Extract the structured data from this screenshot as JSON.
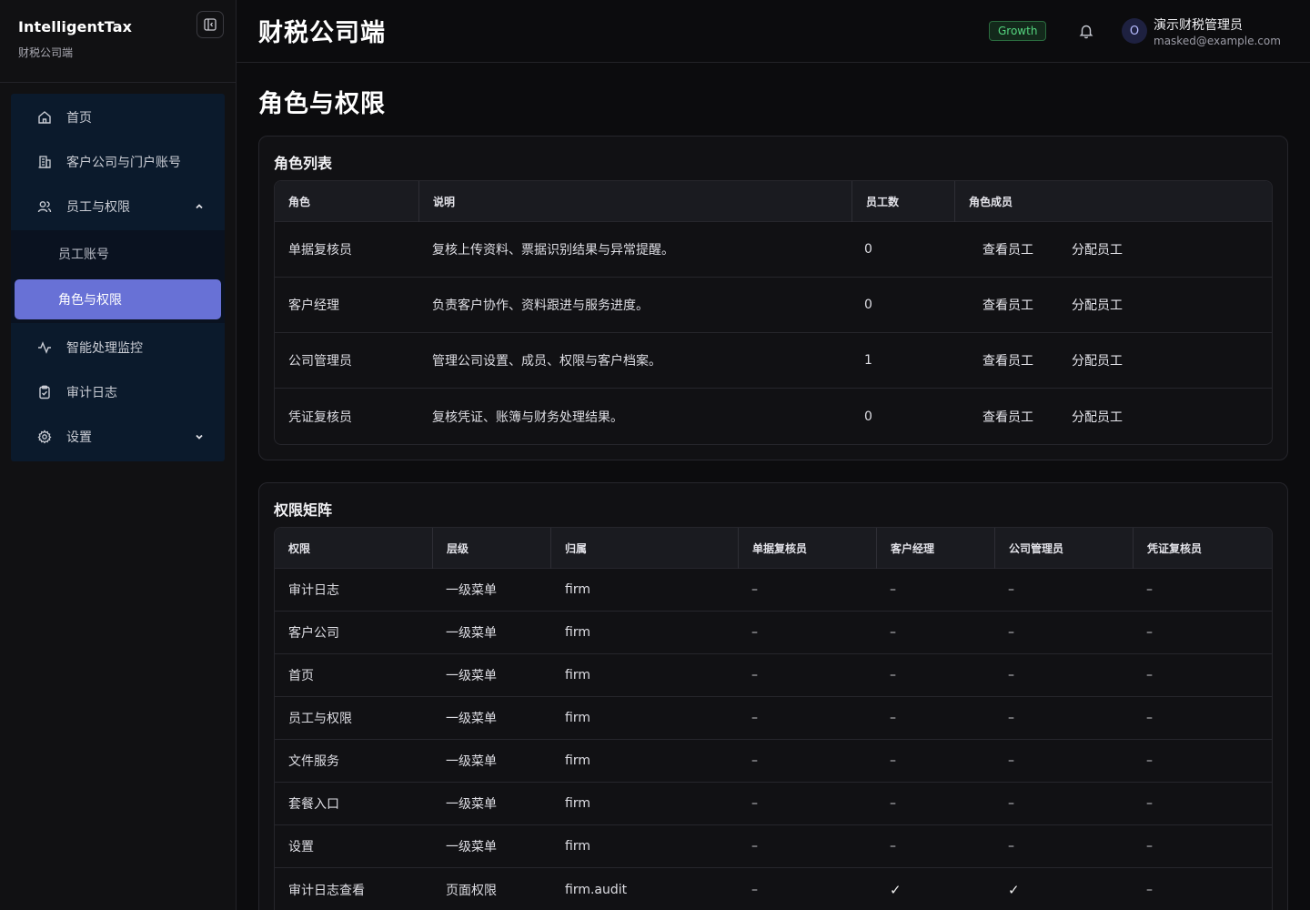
{
  "sidebar": {
    "brand_title": "IntelligentTax",
    "brand_subtitle": "财税公司端",
    "items": [
      {
        "label": "首页",
        "icon": "home-icon"
      },
      {
        "label": "客户公司与门户账号",
        "icon": "building-icon"
      },
      {
        "label": "员工与权限",
        "icon": "users-icon",
        "expanded": true
      },
      {
        "label": "员工账号",
        "sub": true
      },
      {
        "label": "角色与权限",
        "sub": true,
        "active": true
      },
      {
        "label": "智能处理监控",
        "icon": "activity-icon"
      },
      {
        "label": "审计日志",
        "icon": "clipboard-check-icon"
      },
      {
        "label": "设置",
        "icon": "gear-icon",
        "expanded": false
      }
    ]
  },
  "header": {
    "title": "财税公司端",
    "plan_badge": "Growth",
    "avatar_initial": "O",
    "user_name": "演示财税管理员",
    "user_email": "masked@example.com"
  },
  "page": {
    "title": "角色与权限"
  },
  "roles_card": {
    "title": "角色列表",
    "columns": [
      "角色",
      "说明",
      "员工数",
      "角色成员"
    ],
    "view_label": "查看员工",
    "assign_label": "分配员工",
    "rows": [
      {
        "role": "单据复核员",
        "desc": "复核上传资料、票据识别结果与异常提醒。",
        "count": "0"
      },
      {
        "role": "客户经理",
        "desc": "负责客户协作、资料跟进与服务进度。",
        "count": "0"
      },
      {
        "role": "公司管理员",
        "desc": "管理公司设置、成员、权限与客户档案。",
        "count": "1"
      },
      {
        "role": "凭证复核员",
        "desc": "复核凭证、账簿与财务处理结果。",
        "count": "0"
      }
    ]
  },
  "matrix_card": {
    "title": "权限矩阵",
    "columns": [
      "权限",
      "层级",
      "归属",
      "单据复核员",
      "客户经理",
      "公司管理员",
      "凭证复核员"
    ],
    "rows": [
      {
        "perm": "审计日志",
        "level": "一级菜单",
        "scope": "firm",
        "cells": [
          "–",
          "–",
          "–",
          "–"
        ]
      },
      {
        "perm": "客户公司",
        "level": "一级菜单",
        "scope": "firm",
        "cells": [
          "–",
          "–",
          "–",
          "–"
        ]
      },
      {
        "perm": "首页",
        "level": "一级菜单",
        "scope": "firm",
        "cells": [
          "–",
          "–",
          "–",
          "–"
        ]
      },
      {
        "perm": "员工与权限",
        "level": "一级菜单",
        "scope": "firm",
        "cells": [
          "–",
          "–",
          "–",
          "–"
        ]
      },
      {
        "perm": "文件服务",
        "level": "一级菜单",
        "scope": "firm",
        "cells": [
          "–",
          "–",
          "–",
          "–"
        ]
      },
      {
        "perm": "套餐入口",
        "level": "一级菜单",
        "scope": "firm",
        "cells": [
          "–",
          "–",
          "–",
          "–"
        ]
      },
      {
        "perm": "设置",
        "level": "一级菜单",
        "scope": "firm",
        "cells": [
          "–",
          "–",
          "–",
          "–"
        ]
      },
      {
        "perm": "审计日志查看",
        "level": "页面权限",
        "scope": "firm.audit",
        "cells": [
          "–",
          "✓",
          "✓",
          "–"
        ]
      }
    ]
  },
  "colors": {
    "accent": "#6871d6",
    "plan_badge_text": "#55d57f",
    "nav_bg": "#0b1a2c"
  }
}
